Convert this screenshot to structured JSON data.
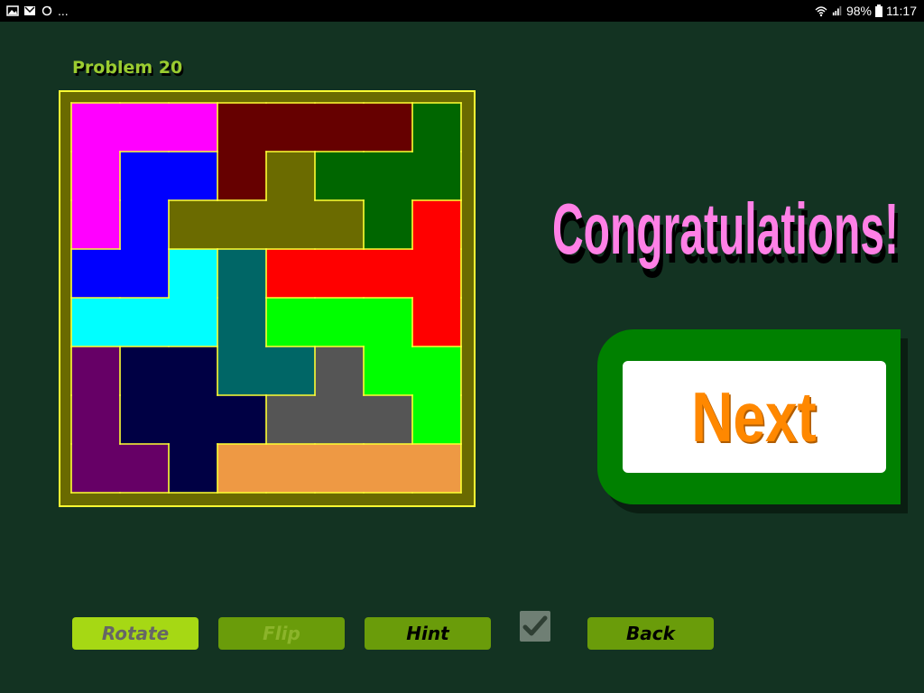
{
  "status_bar": {
    "left_icons": [
      "gallery-icon",
      "gmail-icon",
      "sync-icon"
    ],
    "overflow": "...",
    "battery": "98%",
    "time": "11:17"
  },
  "problem": {
    "title": "Problem 20"
  },
  "board": {
    "frame_color": "#6a6a00",
    "outline_color": "#ffff33",
    "grid": {
      "rows": 8,
      "cols": 8,
      "cells": [
        "PPPMMMMG",
        "PBBMOGGG",
        "PBOOOOGR",
        "BBCTRRRR",
        "CCCTLLLR",
        "UNNTTDLL",
        "UNNNDDDL",
        "UUNFFFFF"
      ]
    },
    "pieces": [
      {
        "id": "P",
        "name": "magenta",
        "color": "#ff00ff"
      },
      {
        "id": "M",
        "name": "maroon",
        "color": "#660000"
      },
      {
        "id": "G",
        "name": "dark-green",
        "color": "#006600"
      },
      {
        "id": "B",
        "name": "blue",
        "color": "#0000ff"
      },
      {
        "id": "O",
        "name": "olive",
        "color": "#6b6b00"
      },
      {
        "id": "R",
        "name": "red",
        "color": "#ff0000"
      },
      {
        "id": "C",
        "name": "cyan",
        "color": "#00ffff"
      },
      {
        "id": "T",
        "name": "teal",
        "color": "#006666"
      },
      {
        "id": "L",
        "name": "lime",
        "color": "#00ff00"
      },
      {
        "id": "U",
        "name": "purple",
        "color": "#660066"
      },
      {
        "id": "N",
        "name": "navy",
        "color": "#000044"
      },
      {
        "id": "D",
        "name": "gray",
        "color": "#555555"
      },
      {
        "id": "F",
        "name": "orange",
        "color": "#ee9944"
      }
    ]
  },
  "message": {
    "text": "Congratulations!",
    "color": "#ff80e6"
  },
  "next_button": {
    "label": "Next",
    "color": "#ff8800"
  },
  "toolbar": {
    "rotate_label": "Rotate",
    "flip_label": "Flip",
    "hint_label": "Hint",
    "back_label": "Back",
    "checkbox_checked": true
  }
}
